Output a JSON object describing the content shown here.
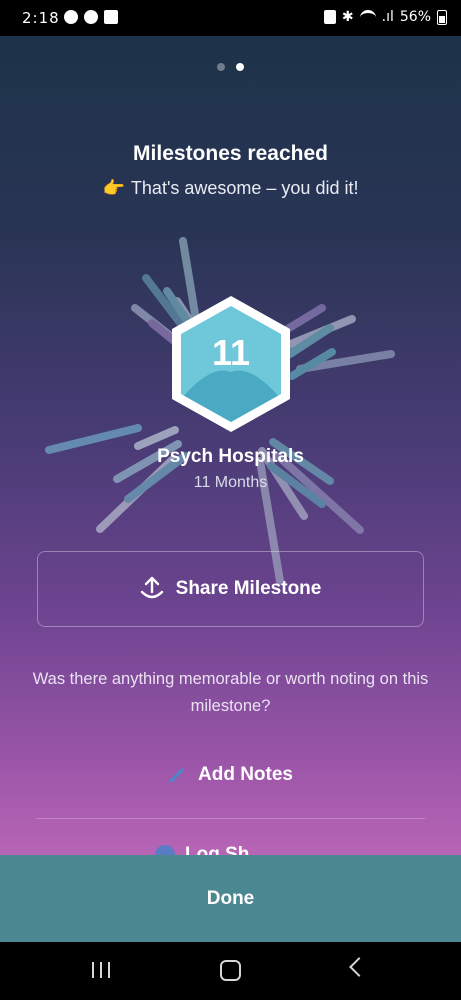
{
  "status": {
    "time": "2:18",
    "battery": "56%"
  },
  "pager": {
    "total": 2,
    "active_index": 1
  },
  "header": {
    "title": "Milestones reached",
    "emoji": "👉",
    "subtitle": "That's awesome – you did it!"
  },
  "milestone": {
    "count": "11",
    "name": "Psych Hospitals",
    "duration": "11 Months"
  },
  "actions": {
    "share_label": "Share Milestone",
    "prompt": "Was there anything memorable or worth noting on this milestone?",
    "add_notes_label": "Add Notes",
    "next_item_label_partial": "Log Sh..."
  },
  "footer": {
    "done_label": "Done"
  },
  "icons": {
    "share": "share-icon",
    "pencil": "pencil-icon",
    "globe": "globe-icon"
  },
  "colors": {
    "accent_teal": "#4b8891",
    "badge_cyan": "#6ec8da"
  }
}
